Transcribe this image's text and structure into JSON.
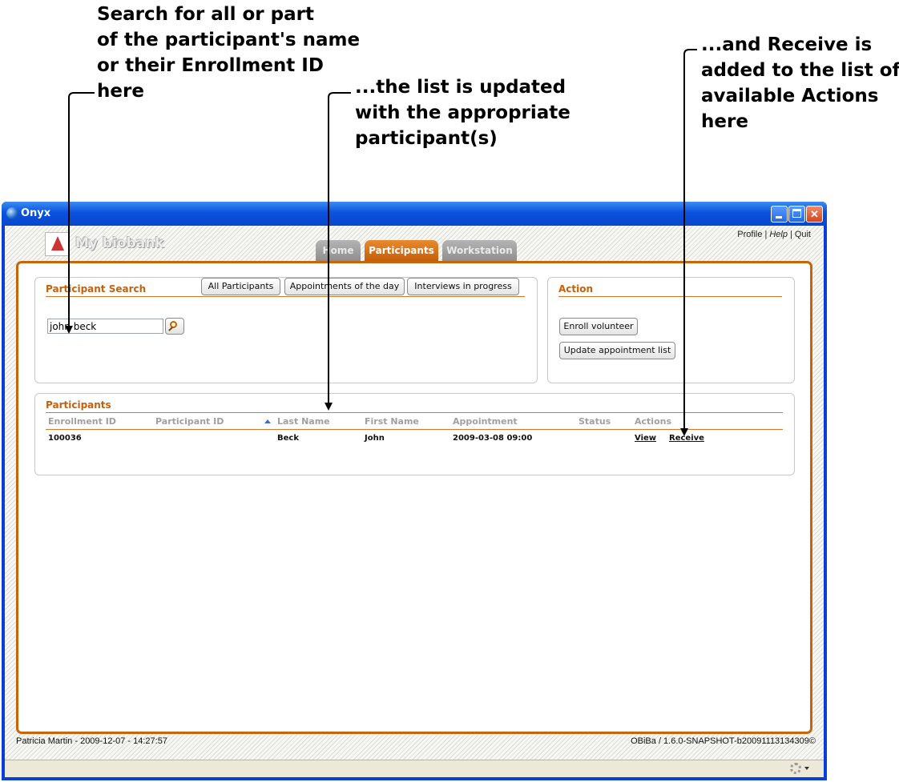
{
  "annotations": {
    "search": [
      "Search for all or part",
      "of the participant's name",
      "or their Enrollment ID",
      "here"
    ],
    "list": [
      "...the list is updated",
      "with the appropriate",
      "participant(s)"
    ],
    "receive": [
      "...and Receive is",
      "added to the list of",
      "available Actions",
      "here"
    ]
  },
  "window": {
    "title": "Onyx"
  },
  "header": {
    "brand": "My biobank",
    "links": {
      "profile": "Profile",
      "help": "Help",
      "quit": "Quit",
      "sep": "|"
    },
    "tabs": [
      {
        "label": "Home",
        "active": false
      },
      {
        "label": "Participants",
        "active": true
      },
      {
        "label": "Workstation",
        "active": false
      }
    ]
  },
  "search_panel": {
    "title": "Participant Search",
    "input_value": "john beck",
    "buttons": [
      "All Participants",
      "Appointments of the day",
      "Interviews in progress"
    ]
  },
  "action_panel": {
    "title": "Action",
    "buttons": [
      "Enroll volunteer",
      "Update appointment list"
    ]
  },
  "participants": {
    "title": "Participants",
    "columns": [
      "Enrollment ID",
      "Participant ID",
      "Last Name",
      "First Name",
      "Appointment",
      "Status",
      "Actions"
    ],
    "rows": [
      {
        "enrollment_id": "100036",
        "participant_id": "",
        "last_name": "Beck",
        "first_name": "John",
        "appointment": "2009-03-08 09:00",
        "status": "",
        "actions": [
          "View",
          "Receive"
        ]
      }
    ]
  },
  "footer": {
    "user_info": "Patricia Martin - 2009-12-07 - 14:27:57",
    "version": "OBiBa / 1.6.0-SNAPSHOT-b20091113134309©"
  }
}
